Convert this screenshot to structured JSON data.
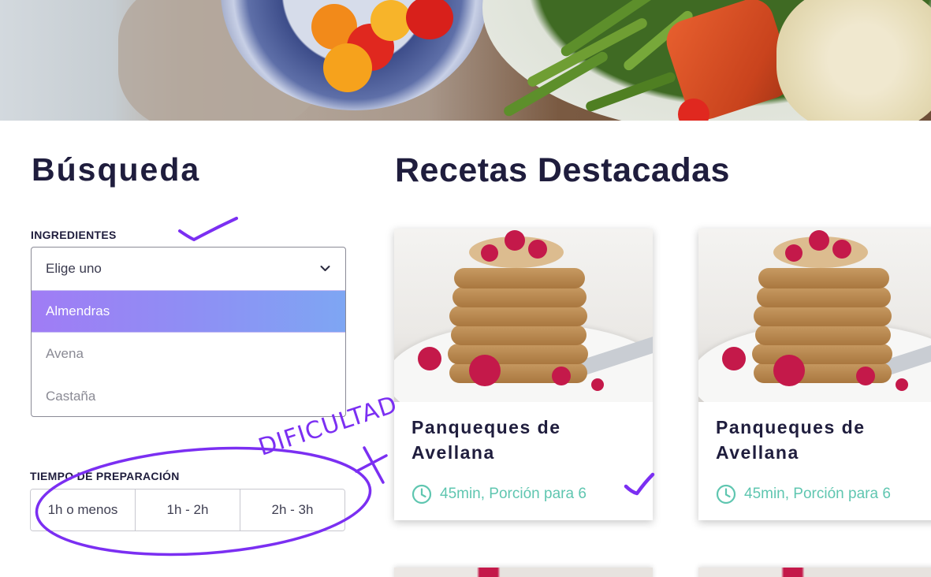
{
  "search": {
    "title": "Búsqueda",
    "ingredients": {
      "label": "INGREDIENTES",
      "placeholder": "Elige uno",
      "options": [
        "Almendras",
        "Avena",
        "Castaña"
      ],
      "selected": "Almendras"
    },
    "prep_time": {
      "label": "TIEMPO DE PREPARACIÓN",
      "options": [
        "1h o menos",
        "1h - 2h",
        "2h - 3h"
      ]
    }
  },
  "featured": {
    "title": "Recetas Destacadas",
    "cards": [
      {
        "title": "Panqueques de Avellana",
        "meta": "45min, Porción para 6"
      },
      {
        "title": "Panqueques de Avellana",
        "meta": "45min, Porción para 6"
      }
    ]
  },
  "annotations": {
    "note": "DIFICULTAD"
  },
  "colors": {
    "accent_gradient_start": "#a07cf5",
    "accent_gradient_end": "#7ea6f3",
    "meta_teal": "#5fc6b0",
    "annotation_purple": "#7b2ff2",
    "heading": "#1f1d3d"
  }
}
